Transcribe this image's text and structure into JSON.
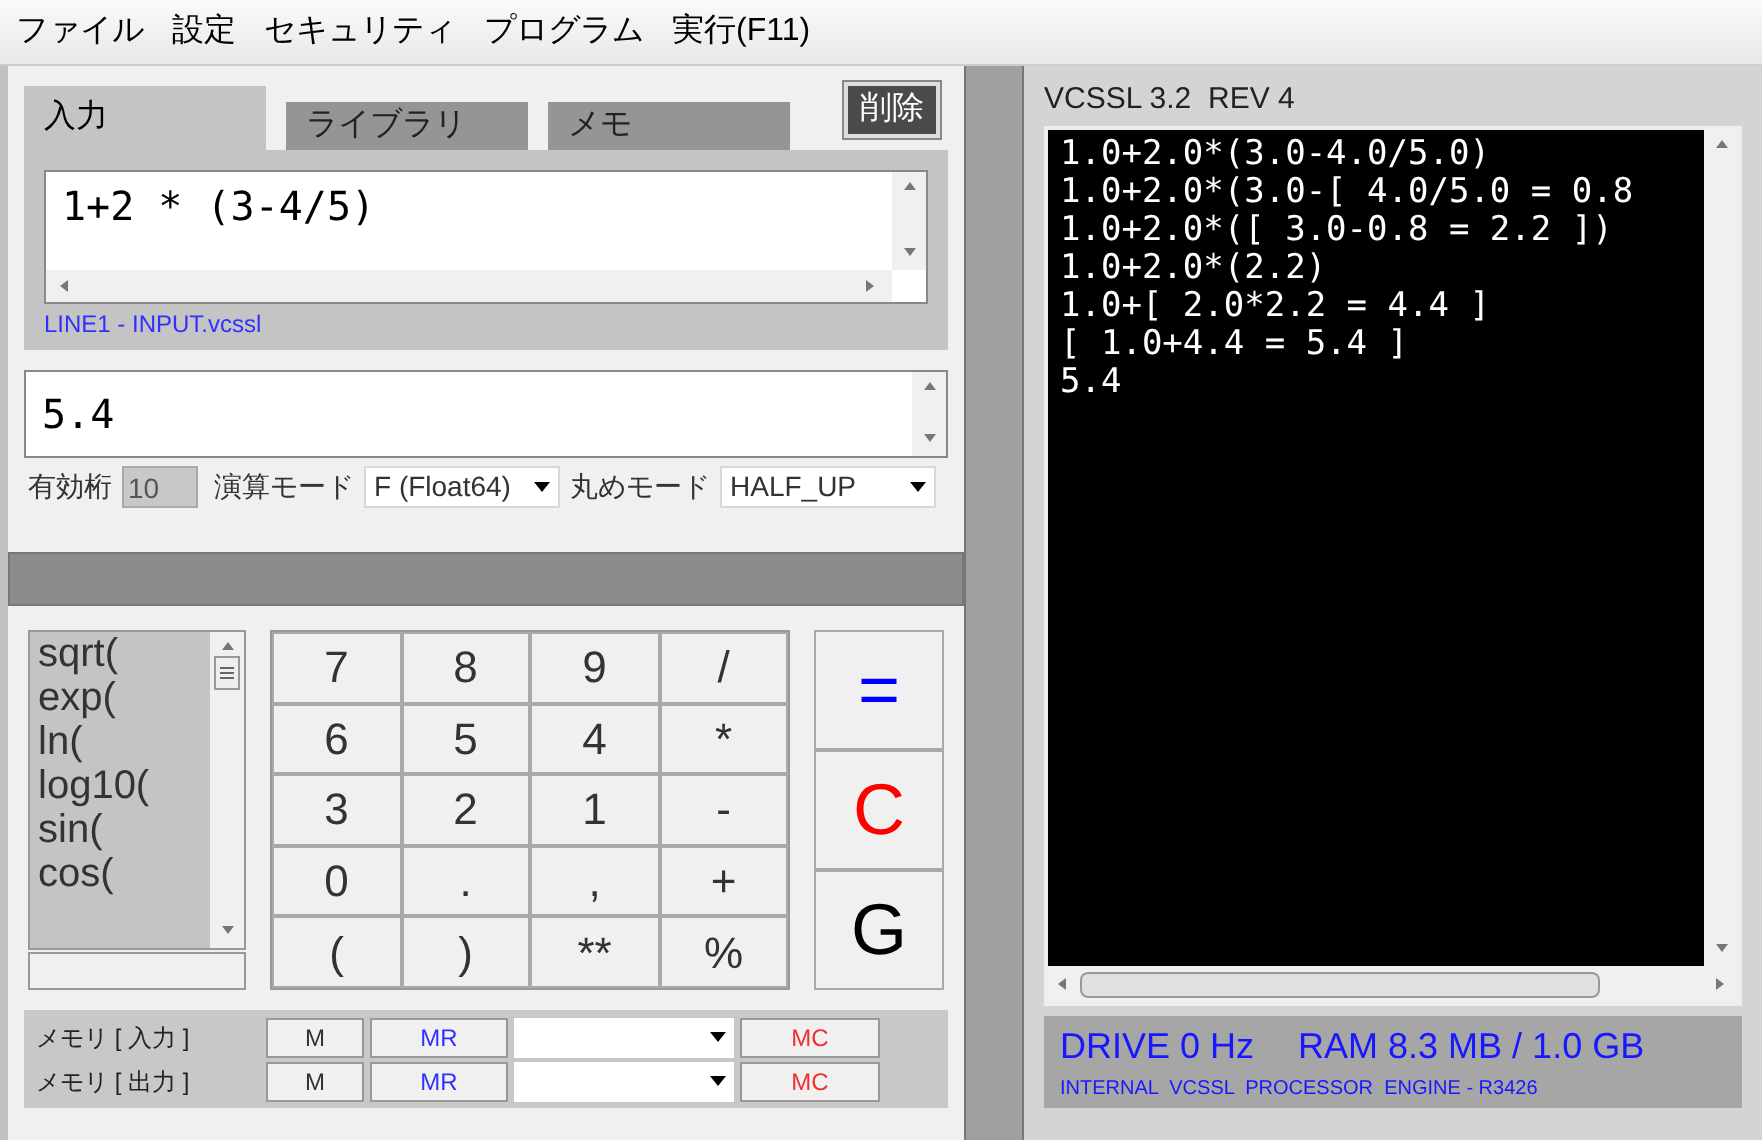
{
  "menu": [
    "ファイル",
    "設定",
    "セキュリティ",
    "プログラム",
    "実行(F11)"
  ],
  "tabs": [
    {
      "label": "入力",
      "selected": true
    },
    {
      "label": "ライブラリ",
      "selected": false
    },
    {
      "label": "メモ",
      "selected": false
    }
  ],
  "delete_button": "削除",
  "input": {
    "value": "1+2 * (3-4/5)",
    "file_label": "LINE1 - INPUT.vcssl"
  },
  "output": {
    "value": "5.4"
  },
  "options": {
    "digits_label": "有効桁",
    "digits": {
      "value": "10",
      "disabled": true
    },
    "mode_label": "演算モード",
    "mode": "F (Float64)",
    "rounding_label": "丸めモード",
    "rounding": "HALF_UP"
  },
  "functions": [
    "sqrt(",
    "exp(",
    "ln(",
    "log10(",
    "sin(",
    "cos("
  ],
  "keys": [
    "7",
    "8",
    "9",
    "/",
    "6",
    "5",
    "4",
    "*",
    "3",
    "2",
    "1",
    "-",
    "0",
    ".",
    ",",
    "+",
    "(",
    ")",
    "**",
    "%"
  ],
  "side_keys": [
    {
      "label": "=",
      "color": "#0000ff"
    },
    {
      "label": "C",
      "color": "#ff0000"
    },
    {
      "label": "G",
      "color": "#000000"
    }
  ],
  "memory": [
    {
      "label": "メモリ [ 入力 ]",
      "m": "M",
      "mr": "MR",
      "mc": "MC"
    },
    {
      "label": "メモリ [ 出力 ]",
      "m": "M",
      "mr": "MR",
      "mc": "MC"
    }
  ],
  "console": {
    "title": "VCSSL 3.2  REV 4",
    "lines": [
      "1.0+2.0*(3.0-4.0/5.0)",
      "1.0+2.0*(3.0-[ 4.0/5.0 = 0.8",
      "1.0+2.0*([ 3.0-0.8 = 2.2 ])",
      "1.0+2.0*(2.2)",
      "1.0+[ 2.0*2.2 = 4.4 ]",
      "[ 1.0+4.4 = 5.4 ]",
      "5.4"
    ]
  },
  "status": {
    "drive": "DRIVE 0 Hz",
    "ram": "RAM 8.3 MB / 1.0 GB",
    "engine": "INTERNAL  VCSSL  PROCESSOR  ENGINE - R3426"
  }
}
